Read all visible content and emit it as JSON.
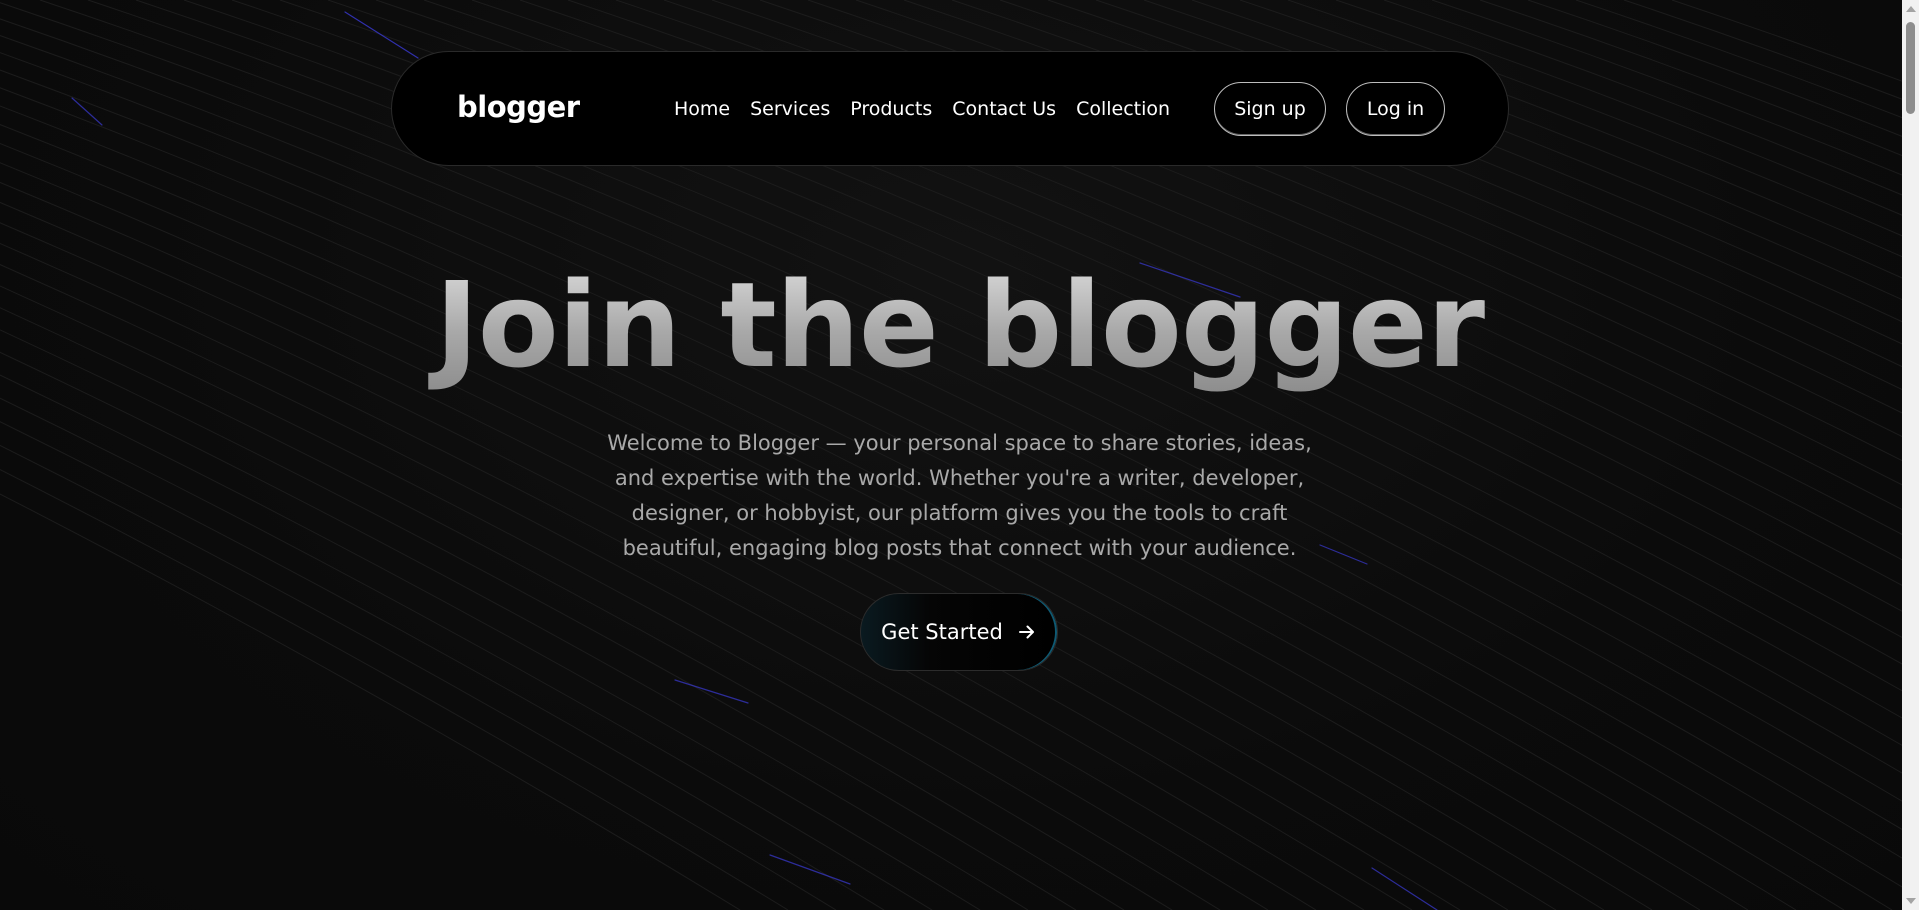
{
  "logo": {
    "text": "blogger"
  },
  "nav": {
    "links": [
      "Home",
      "Services",
      "Products",
      "Contact Us",
      "Collection"
    ],
    "signup_label": "Sign up",
    "login_label": "Log in"
  },
  "hero": {
    "title": "Join the blogger",
    "description": "Welcome to Blogger — your personal space to share stories, ideas, and expertise with the world. Whether you're a writer, developer, designer, or hobbyist, our platform gives you the tools to craft beautiful, engaging blog posts that connect with your audience.",
    "cta_label": "Get Started",
    "cta_icon": "arrow-right-icon"
  },
  "colors": {
    "background": "#0b0b0b",
    "navbar": "#000000",
    "text": "#ffffff",
    "muted_text": "#a9a9a9",
    "accent_line": "#3b3bd1",
    "cta_glow": "#0f5a73"
  }
}
